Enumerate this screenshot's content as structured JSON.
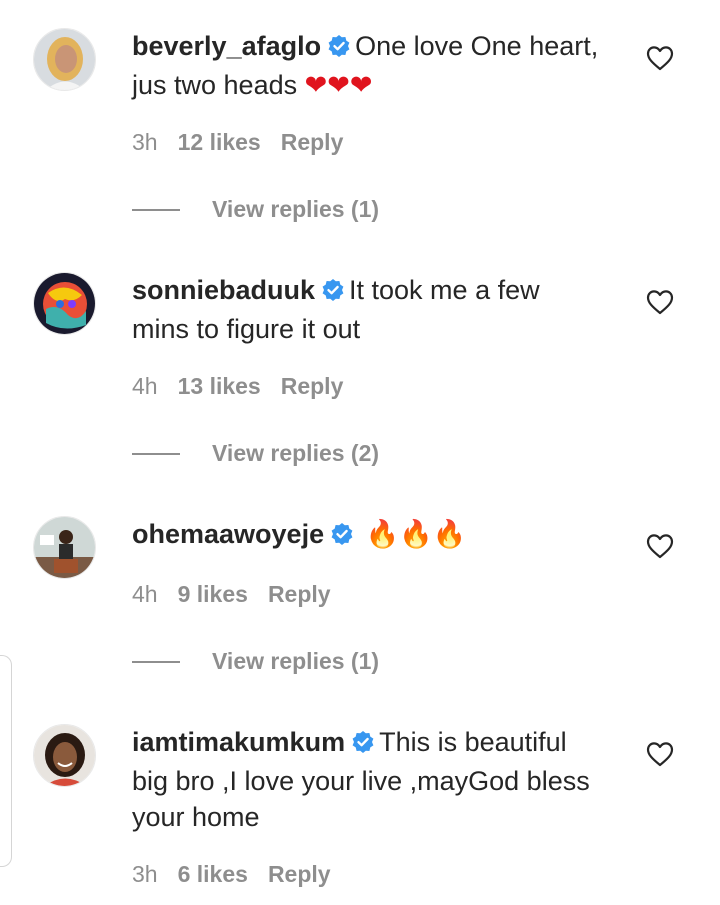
{
  "comments": [
    {
      "username": "beverly_afaglo",
      "text_line1": "One love One heart,",
      "text_line2": "jus two heads",
      "emojis": "❤❤❤",
      "time": "3h",
      "likes": "12 likes",
      "reply_label": "Reply",
      "view_replies": "View replies (1)"
    },
    {
      "username": "sonniebaduuk",
      "text_line1": "It took me a few",
      "text_line2": "mins to figure it out",
      "time": "4h",
      "likes": "13 likes",
      "reply_label": "Reply",
      "view_replies": "View replies (2)"
    },
    {
      "username": "ohemaawoyeje",
      "emojis": "🔥🔥🔥",
      "time": "4h",
      "likes": "9 likes",
      "reply_label": "Reply",
      "view_replies": "View replies (1)"
    },
    {
      "username": "iamtimakumkum",
      "text_line1": "This is beautiful",
      "text_line2": "big bro ,I love your live ,mayGod bless",
      "text_line3": "your home",
      "time": "3h",
      "likes": "6 likes",
      "reply_label": "Reply"
    }
  ],
  "icons": {
    "verified": "verified-badge-icon",
    "like": "heart-outline-icon"
  },
  "colors": {
    "text": "#262626",
    "secondary": "#8e8e8e",
    "verified": "#3897f0",
    "heart_emoji": "#e0141e",
    "fire_emoji": "#f2711c"
  }
}
